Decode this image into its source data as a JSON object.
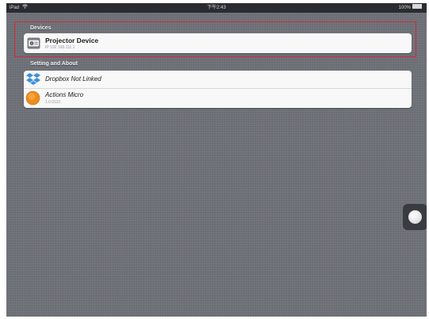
{
  "status_bar": {
    "carrier": "iPad",
    "time": "下午2:43",
    "battery": "100%"
  },
  "sections": {
    "devices": {
      "header": "Devices",
      "items": [
        {
          "title": "Projector Device",
          "subtitle": "IP:192.168.111.1",
          "icon": "projector-icon"
        }
      ]
    },
    "settings": {
      "header": "Setting and About",
      "items": [
        {
          "title": "Dropbox Not Linked",
          "subtitle": "",
          "icon": "dropbox-icon"
        },
        {
          "title": "Actions Micro",
          "subtitle": "1.0.0110",
          "icon": "actions-micro-icon"
        }
      ]
    }
  },
  "colors": {
    "highlight": "#d12a3a",
    "background": "#6e7178",
    "dropbox": "#3d8fd8",
    "actions_micro": "#f08a1c"
  }
}
